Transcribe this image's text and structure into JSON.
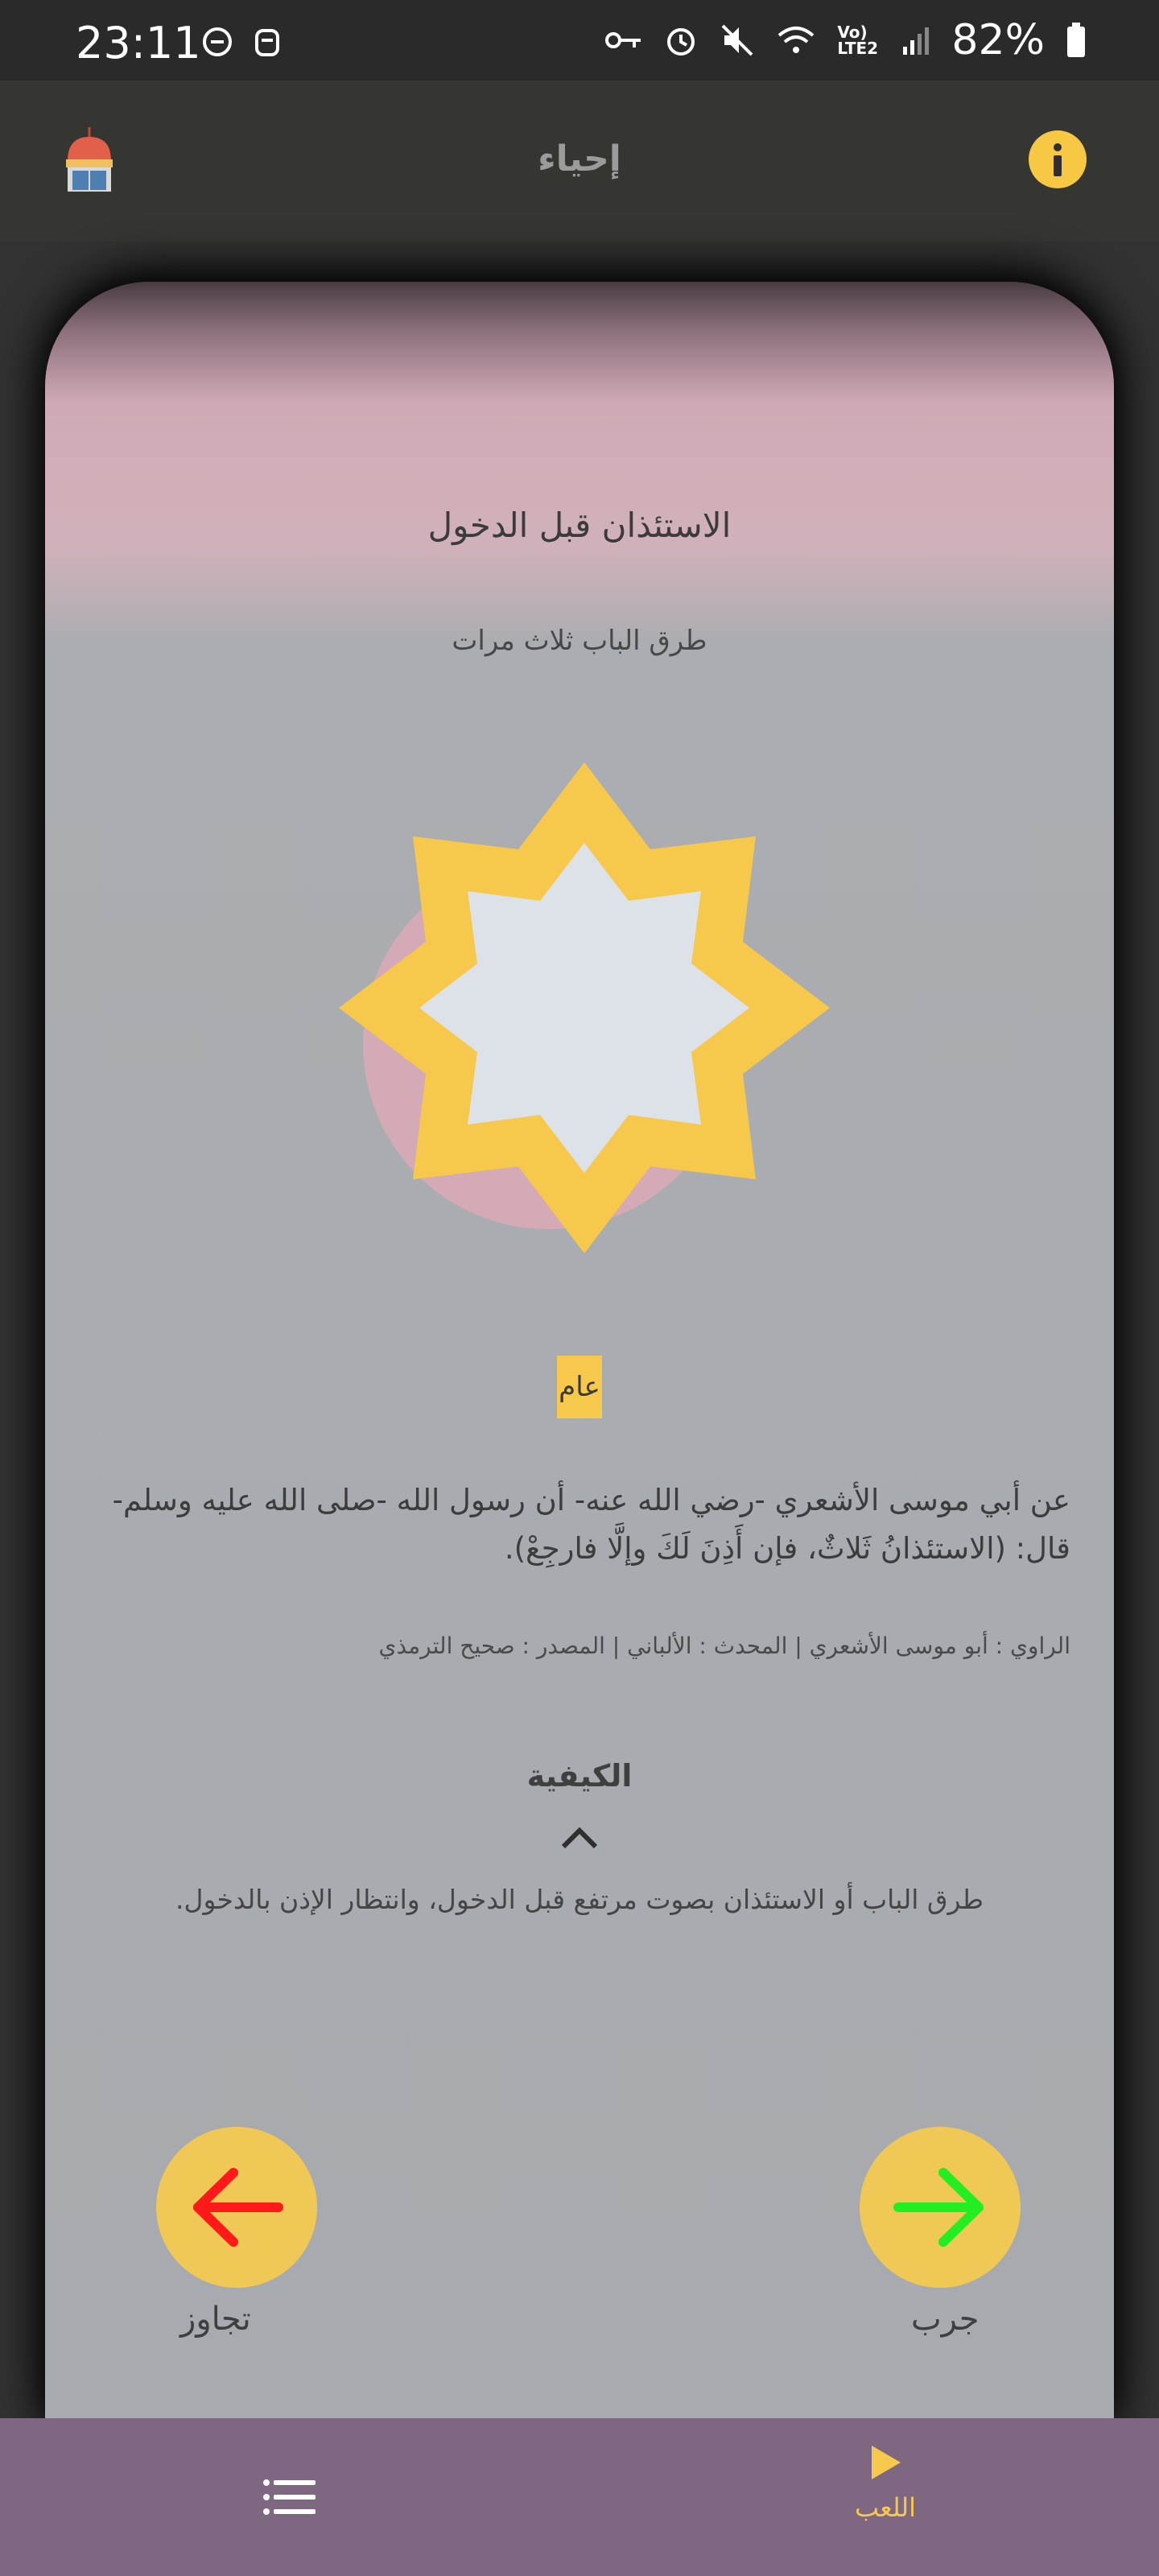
{
  "status_bar": {
    "time": "23:11",
    "battery": "82%",
    "network_label": "Vo) LTE2",
    "icons": [
      "dnd-icon",
      "face-icon",
      "key-icon",
      "alarm-icon",
      "mute-icon",
      "wifi-icon",
      "signal-icon",
      "battery-icon"
    ]
  },
  "app_bar": {
    "title": "إحياء",
    "logo_icon": "mosque-book-logo",
    "info_icon": "info-icon"
  },
  "card": {
    "title": "الاستئذان قبل الدخول",
    "subtitle": "طرق الباب ثلاث مرات",
    "category": "عام",
    "hadith": "عن أبي موسى الأشعري -رضي الله عنه- أن رسول الله -صلى الله عليه وسلم- قال: (الاستئذانُ ثَلاثٌ، فإن أَذِنَ لَكَ وإلَّا فارجِعْ).",
    "source": "الراوي : أبو موسى الأشعري | المحدث : الألباني | المصدر : صحيح الترمذي",
    "how_title": "الكيفية",
    "how_text": "طرق الباب أو الاستئذان بصوت مرتفع قبل الدخول، وانتظار الإذن بالدخول."
  },
  "actions": {
    "skip_label": "تجاوز",
    "try_label": "جرب",
    "skip_icon": "arrow-left-icon",
    "try_icon": "arrow-right-icon"
  },
  "bottom_nav": {
    "list_icon": "list-icon",
    "play_icon": "play-icon",
    "play_label": "اللعب"
  },
  "colors": {
    "accent": "#f6c84b",
    "nav_bg": "#7e6781",
    "skip_arrow": "#ff1a1a",
    "try_arrow": "#22ee22"
  }
}
